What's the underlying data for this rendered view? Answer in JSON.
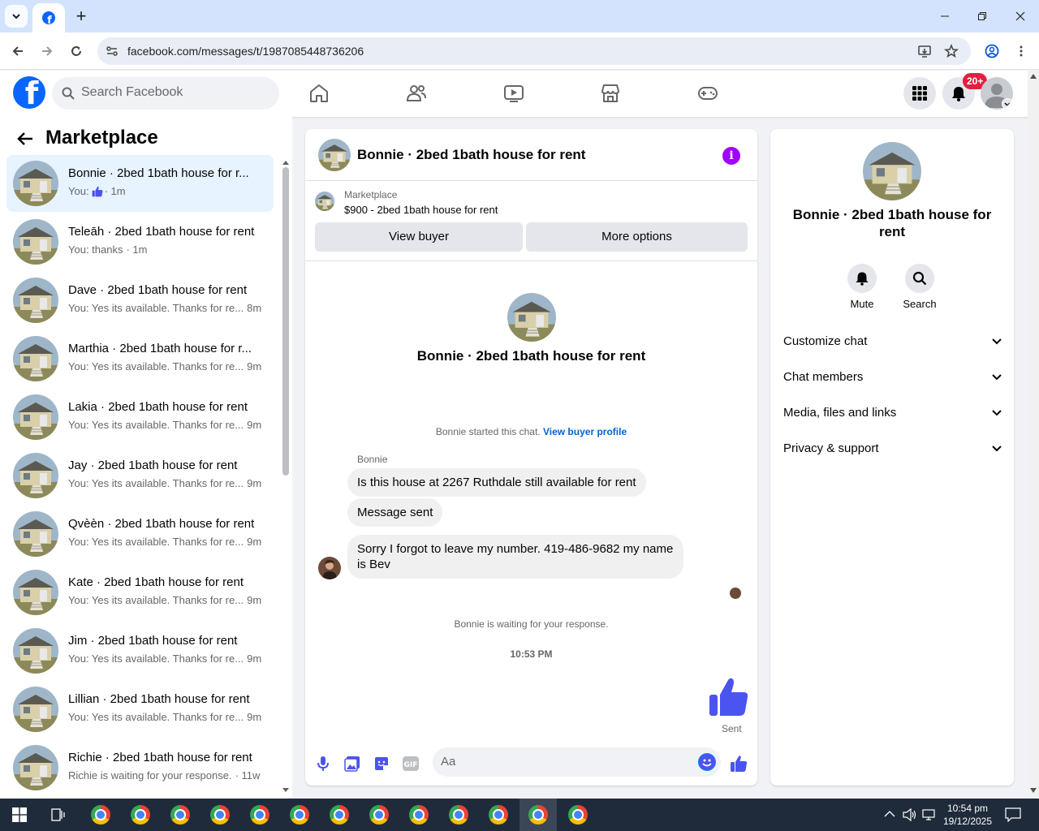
{
  "browser": {
    "url": "facebook.com/messages/t/1987085448736206"
  },
  "header": {
    "search_placeholder": "Search Facebook",
    "notifications_badge": "20+"
  },
  "left": {
    "title": "Marketplace",
    "conversations": [
      {
        "name": "Bonnie · 2bed 1bath house for r...",
        "preview": "You:",
        "time": "· 1m",
        "like": true
      },
      {
        "name": "Teleāh · 2bed 1bath house for rent",
        "preview": "You: thanks",
        "time": "· 1m"
      },
      {
        "name": "Dave · 2bed 1bath house for rent",
        "preview": "You: Yes its available. Thanks for re...",
        "time": "8m"
      },
      {
        "name": "Marthia · 2bed 1bath house for r...",
        "preview": "You: Yes its available. Thanks for re...",
        "time": "9m"
      },
      {
        "name": "Lakia · 2bed 1bath house for rent",
        "preview": "You: Yes its available. Thanks for re...",
        "time": "9m"
      },
      {
        "name": "Jay · 2bed 1bath house for rent",
        "preview": "You: Yes its available. Thanks for re...",
        "time": "9m"
      },
      {
        "name": "Qvèèn · 2bed 1bath house for rent",
        "preview": "You: Yes its available. Thanks for re...",
        "time": "9m"
      },
      {
        "name": "Kate · 2bed 1bath house for rent",
        "preview": "You: Yes its available. Thanks for re...",
        "time": "9m"
      },
      {
        "name": "Jim · 2bed 1bath house for rent",
        "preview": "You: Yes its available. Thanks for re...",
        "time": "9m"
      },
      {
        "name": "Lillian · 2bed 1bath house for rent",
        "preview": "You: Yes its available. Thanks for re...",
        "time": "9m"
      },
      {
        "name": "Richie · 2bed 1bath house for rent",
        "preview": "Richie is waiting for your response.",
        "time": "· 11w"
      }
    ]
  },
  "chat": {
    "title": "Bonnie · 2bed 1bath house for rent",
    "listing_source": "Marketplace",
    "listing_title": "$900 - 2bed 1bath house for rent",
    "view_buyer": "View buyer",
    "more_options": "More options",
    "center_name": "Bonnie · 2bed 1bath house for rent",
    "started_text": "Bonnie started this chat.",
    "view_buyer_profile": "View buyer profile",
    "sender": "Bonnie",
    "messages": [
      "Is this house at 2267 Ruthdale still available for rent",
      "Message sent",
      "Sorry I forgot to leave my number. 419-486-9682 my name is Bev"
    ],
    "waiting": "Bonnie is waiting for your response.",
    "timestamp": "10:53 PM",
    "sent_label": "Sent",
    "input_placeholder": "Aa"
  },
  "info": {
    "name": "Bonnie · 2bed 1bath house for rent",
    "mute": "Mute",
    "search": "Search",
    "sections": [
      "Customize chat",
      "Chat members",
      "Media, files and links",
      "Privacy & support"
    ]
  },
  "taskbar": {
    "time": "10:54 pm",
    "date": "19/12/2025"
  },
  "colors": {
    "fb_blue": "#0866ff",
    "messenger_accent": "#4b53f0",
    "info_purple": "#a100ff"
  }
}
